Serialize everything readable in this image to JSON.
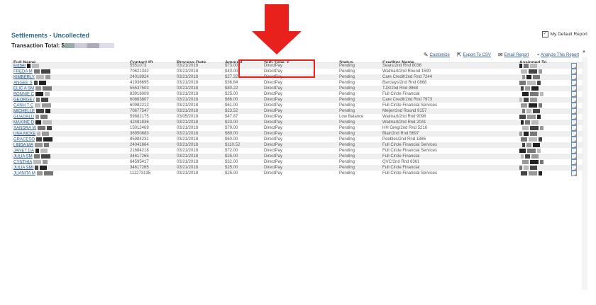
{
  "page": {
    "title": "Settlements - Uncollected",
    "transaction_total_label": "Transaction Total: $",
    "default_report_label": "My Default Report",
    "default_report_checked": true
  },
  "toolbar": {
    "customize": "Customize",
    "export_csv": "Export To CSV",
    "email_report": "Email Report",
    "analyze_report": "Analyze This Report"
  },
  "columns": {
    "full_name": "Full Name",
    "contact_id": "Contact ID",
    "process_date": "Process Date",
    "amount": "Amount",
    "sub_type": "Sub Type",
    "status": "Status",
    "creditor_name": "Creditor Name",
    "assigned_to": "Assigned To"
  },
  "colors": {
    "accent": "#2d6b8a",
    "annotation": "#e8211d"
  },
  "rows": [
    {
      "name": "Esther",
      "contact_id": "5551073",
      "process_date": "03/21/2018",
      "amount": "$73.00",
      "sub_type": "DirectPay",
      "status": "Pending",
      "creditor": "Sears/2nd Rnd 8036"
    },
    {
      "name": "FREDA M",
      "contact_id": "70621342",
      "process_date": "03/21/2018",
      "amount": "$40.00",
      "sub_type": "DirectPay",
      "status": "Pending",
      "creditor": "Walmart/2nd Round 1590"
    },
    {
      "name": "KIMBERLY",
      "contact_id": "24018924",
      "process_date": "03/21/2018",
      "amount": "$27.32",
      "sub_type": "DirectPay",
      "status": "Pending",
      "creditor": "Care Credit/2nd Rnd 7244"
    },
    {
      "name": "ANGEE S",
      "contact_id": "41936695",
      "process_date": "03/21/2018",
      "amount": "$36.84",
      "sub_type": "DirectPay",
      "status": "Pending",
      "creditor": "Barclays/2nd Rnd 0868"
    },
    {
      "name": "ELIC A SM",
      "contact_id": "55537503",
      "process_date": "03/21/2018",
      "amount": "$80.22",
      "sub_type": "DirectPay",
      "status": "Pending",
      "creditor": "TJX/2nd Rnd 9968"
    },
    {
      "name": "BONNIE C",
      "contact_id": "83916009",
      "process_date": "03/21/2018",
      "amount": "$25.00",
      "sub_type": "DirectPay",
      "status": "Pending",
      "creditor": "Full Circle Financial"
    },
    {
      "name": "GEORGE (",
      "contact_id": "60883807",
      "process_date": "03/21/2018",
      "amount": "$66.00",
      "sub_type": "DirectPay",
      "status": "Pending",
      "creditor": "Care Credit/2nd Rnd 7973"
    },
    {
      "name": "CANH T C",
      "contact_id": "60982213",
      "process_date": "03/21/2018",
      "amount": "$61.00",
      "sub_type": "DirectPay",
      "status": "Pending",
      "creditor": "Full Circle Financial Services"
    },
    {
      "name": "MICHELLE",
      "contact_id": "70677547",
      "process_date": "03/21/2018",
      "amount": "$23.52",
      "sub_type": "DirectPay",
      "status": "Pending",
      "creditor": "Meijer/2nd Round 9157"
    },
    {
      "name": "GUADALU",
      "contact_id": "59882175",
      "process_date": "03/05/2018",
      "amount": "$47.87",
      "sub_type": "DirectPay",
      "status": "Low Balance",
      "creditor": "Walmart/2nd Rnd 9098"
    },
    {
      "name": "MAXINE D",
      "contact_id": "42481836",
      "process_date": "03/21/2018",
      "amount": "$23.00",
      "sub_type": "DirectPay",
      "status": "Pending",
      "creditor": "Walmart/2nd Rnd 2041"
    },
    {
      "name": "SANDRA W",
      "contact_id": "15012469",
      "process_date": "03/21/2018",
      "amount": "$79.00",
      "sub_type": "DirectPay",
      "status": "Pending",
      "creditor": "HH Greg/2nd Rnd 5216"
    },
    {
      "name": "UNA MCKE",
      "contact_id": "36950683",
      "process_date": "03/21/2018",
      "amount": "$69.00",
      "sub_type": "DirectPay",
      "status": "Pending",
      "creditor": "Blair/2nd Rnd 5697"
    },
    {
      "name": "GRACESO",
      "contact_id": "85984231",
      "process_date": "03/21/2018",
      "amount": "$60.00",
      "sub_type": "DirectPay",
      "status": "Pending",
      "creditor": "Peebles/2nd Rnd 1886"
    },
    {
      "name": "LINDA MA",
      "contact_id": "24041664",
      "process_date": "03/21/2018",
      "amount": "$110.52",
      "sub_type": "DirectPay",
      "status": "Pending",
      "creditor": "Full Circle Financial Services"
    },
    {
      "name": "JANET DA",
      "contact_id": "21684218",
      "process_date": "03/21/2018",
      "amount": "$72.00",
      "sub_type": "DirectPay",
      "status": "Pending",
      "creditor": "Full Circle Financial Services"
    },
    {
      "name": "JULIA SM",
      "contact_id": "34617265",
      "process_date": "03/21/2018",
      "amount": "$25.00",
      "sub_type": "DirectPay",
      "status": "Pending",
      "creditor": "Full Circle Financial"
    },
    {
      "name": "CYNTHIA",
      "contact_id": "64595417",
      "process_date": "03/21/2018",
      "amount": "$32.00",
      "sub_type": "DirectPay",
      "status": "Pending",
      "creditor": "QVC/2nd Rnd 6361"
    },
    {
      "name": "JULIA SMI",
      "contact_id": "34617265",
      "process_date": "03/21/2018",
      "amount": "$25.00",
      "sub_type": "DirectPay",
      "status": "Pending",
      "creditor": "Full Circle Financial"
    },
    {
      "name": "JUANITA M",
      "contact_id": "111273135",
      "process_date": "03/21/2018",
      "amount": "$25.00",
      "sub_type": "DirectPay",
      "status": "Pending",
      "creditor": "Full Circle Financial Services"
    }
  ]
}
